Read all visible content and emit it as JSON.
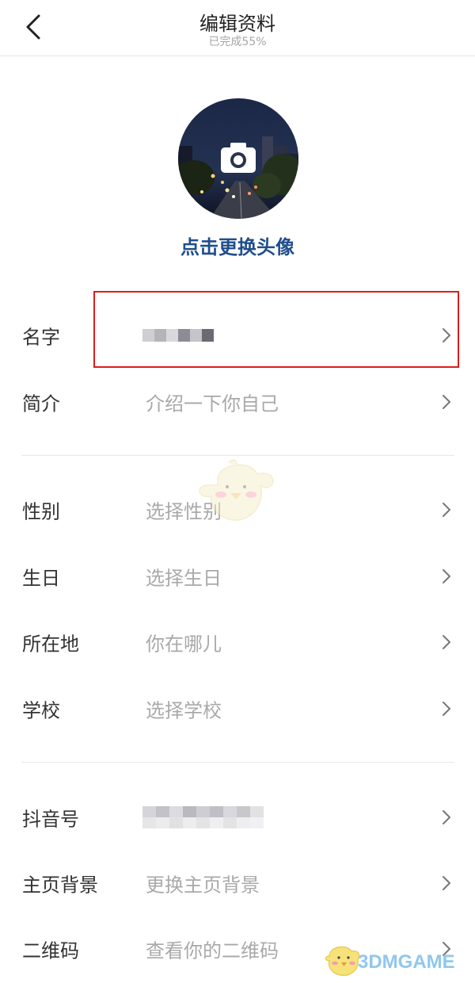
{
  "header": {
    "title": "编辑资料",
    "subtitle": "已完成55%"
  },
  "avatar": {
    "change_label": "点击更换头像"
  },
  "rows": {
    "name": {
      "label": "名字",
      "value": ""
    },
    "bio": {
      "label": "简介",
      "value": "介绍一下你自己"
    },
    "gender": {
      "label": "性别",
      "value": "选择性别"
    },
    "birthday": {
      "label": "生日",
      "value": "选择生日"
    },
    "location": {
      "label": "所在地",
      "value": "你在哪儿"
    },
    "school": {
      "label": "学校",
      "value": "选择学校"
    },
    "douyin_id": {
      "label": "抖音号",
      "value": ""
    },
    "homepage_bg": {
      "label": "主页背景",
      "value": "更换主页背景"
    },
    "qrcode": {
      "label": "二维码",
      "value": "查看你的二维码"
    }
  },
  "watermark": {
    "text": "3DMGAME"
  },
  "colors": {
    "accent_link": "#1f4e8c",
    "highlight_border": "#e01b1b",
    "placeholder_text": "#a9a9a9"
  },
  "icons": {
    "back": "back-chevron-icon",
    "row_arrow": "chevron-right-icon",
    "camera": "camera-icon"
  }
}
